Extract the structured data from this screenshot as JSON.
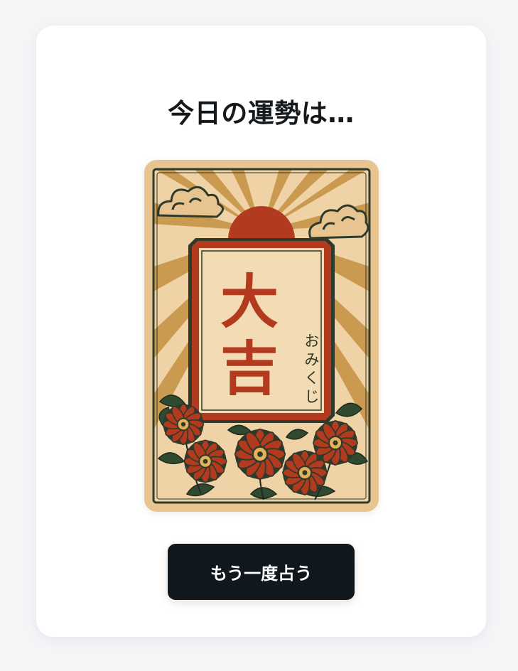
{
  "result": {
    "heading": "今日の運勢は…",
    "fortune": "大吉",
    "fortune_chars": [
      "大",
      "吉"
    ],
    "subtitle": "おみくじ",
    "subtitle_chars": [
      "お",
      "み",
      "く",
      "じ"
    ]
  },
  "actions": {
    "retry_label": "もう一度占う"
  },
  "colors": {
    "background": "#f4f5f7",
    "card": "#ffffff",
    "button": "#11181d",
    "paper": "#e8c590",
    "vermilion": "#b23a1f",
    "ink": "#2f3a2a",
    "ray": "#c99a4f"
  },
  "icons": {
    "card_art": "omikuji-card-illustration",
    "sun": "rising-sun-icon",
    "cloud": "cloud-icon",
    "flower": "chrysanthemum-icon"
  }
}
